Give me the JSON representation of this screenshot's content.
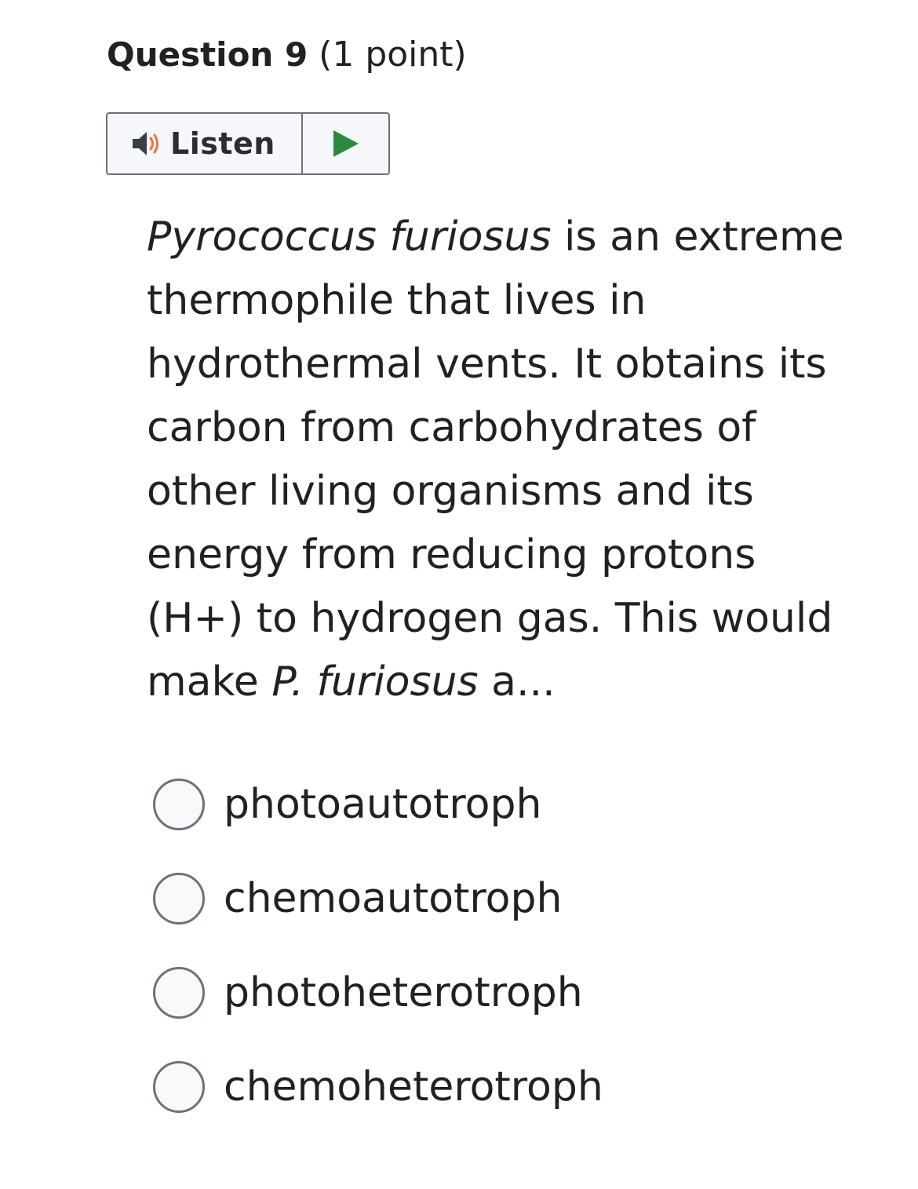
{
  "question": {
    "label": "Question 9",
    "points": "(1 point)"
  },
  "listen": {
    "label": "Listen"
  },
  "question_text": {
    "species_italic": "Pyrococcus furiosus",
    "part1": " is an extreme thermophile that lives in hydrothermal vents. It obtains its carbon from carbohydrates of other living organisms and its energy from reducing protons (H+) to hydrogen gas. This would make ",
    "species_abbrev_italic": "P. furiosus",
    "part2": " a..."
  },
  "options": [
    {
      "label": "photoautotroph"
    },
    {
      "label": "chemoautotroph"
    },
    {
      "label": "photoheterotroph"
    },
    {
      "label": "chemoheterotroph"
    }
  ],
  "colors": {
    "speaker": "#3b3e45",
    "speaker_waves": "#e8743b",
    "play": "#2a8a3e",
    "border": "#6d7278"
  }
}
